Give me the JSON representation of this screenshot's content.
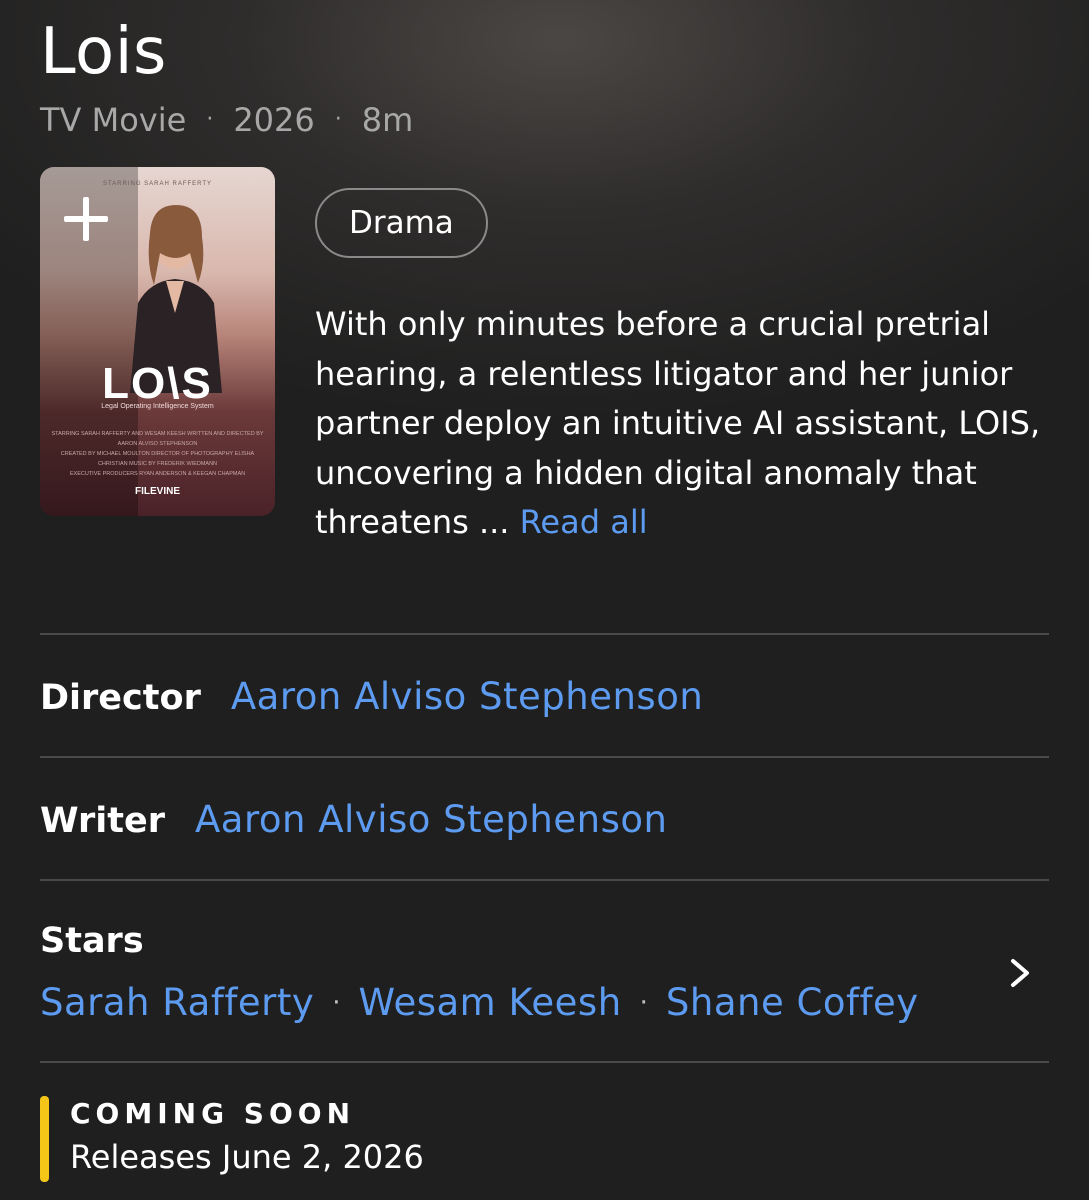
{
  "title": "Lois",
  "meta": {
    "type": "TV Movie",
    "year": "2026",
    "runtime": "8m",
    "separator": "·"
  },
  "poster": {
    "starring": "STARRING SARAH RAFFERTY",
    "logo_text": "LO\\S",
    "logo_subtitle": "Legal Operating Intelligence System",
    "credits_line1": "STARRING SARAH RAFFERTY AND WESAM KEESH WRITTEN AND DIRECTED BY AARON ALVISO STEPHENSON",
    "credits_line2": "CREATED BY MICHAEL MOULTON DIRECTOR OF PHOTOGRAPHY ELISHA CHRISTIAN MUSIC BY FREDERIK WIEDMANN",
    "credits_line3": "EXECUTIVE PRODUCERS RYAN ANDERSON & KEEGAN CHAPMAN",
    "studio": "FILEVINE",
    "add_icon": "plus-icon"
  },
  "genre": "Drama",
  "description": {
    "text": "With only minutes before a crucial pretrial hearing, a relentless litigator and her junior partner deploy an intuitive AI assistant, LOIS, uncovering a hidden digital anomaly that threatens ... ",
    "read_all": "Read all"
  },
  "credits": {
    "director_label": "Director",
    "director_name": "Aaron Alviso Stephenson",
    "writer_label": "Writer",
    "writer_name": "Aaron Alviso Stephenson",
    "stars_label": "Stars",
    "stars": [
      "Sarah Rafferty",
      "Wesam Keesh",
      "Shane Coffey"
    ],
    "stars_separator": "·",
    "chevron_icon": "chevron-right-icon"
  },
  "coming_soon": {
    "label": "COMING SOON",
    "release": "Releases June 2, 2026",
    "accent_color": "#f5c518"
  },
  "colors": {
    "link": "#5d9bf0",
    "background": "#1f1f1f"
  }
}
